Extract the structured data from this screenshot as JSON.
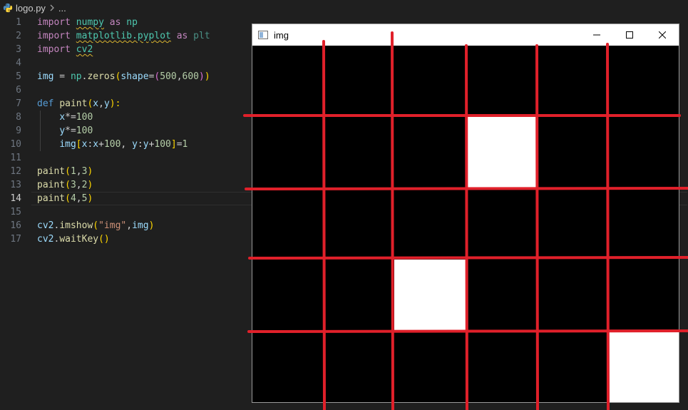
{
  "breadcrumb": {
    "file": "logo.py",
    "more": "..."
  },
  "line_numbers": [
    "1",
    "2",
    "3",
    "4",
    "5",
    "6",
    "7",
    "8",
    "9",
    "10",
    "11",
    "12",
    "13",
    "14",
    "15",
    "16",
    "17"
  ],
  "active_line": 14,
  "code": {
    "l1": {
      "kw": "import",
      "mod": "numpy",
      "kw2": "as",
      "alias": "np"
    },
    "l2": {
      "kw": "import",
      "mod": "matplotlib.pyplot",
      "kw2": "as",
      "alias": "plt"
    },
    "l3": {
      "kw": "import",
      "mod": "cv2"
    },
    "l5": {
      "var": "img",
      "op": " = ",
      "mod": "np",
      "dot": ".",
      "fn": "zeros",
      "po": "(",
      "param": "shape",
      "eq": "=",
      "pi": "(",
      "a": "500",
      "comma": ",",
      "b": "600",
      "pic": ")",
      "pc": ")"
    },
    "l7": {
      "kw": "def",
      "fn": "paint",
      "po": "(",
      "x": "x",
      "comma": ",",
      "y": "y",
      "pc": "):"
    },
    "l8": {
      "var": "x",
      "op": "*=",
      "num": "100"
    },
    "l9": {
      "var": "y",
      "op": "*=",
      "num": "100"
    },
    "l10": {
      "var": "img",
      "bo": "[",
      "x1": "x",
      "c1": ":",
      "x2": "x",
      "plus1": "+",
      "n1": "100",
      "comma": ", ",
      "y1": "y",
      "c2": ":",
      "y2": "y",
      "plus2": "+",
      "n2": "100",
      "bc": "]",
      "eq": "=",
      "val": "1"
    },
    "l12": {
      "fn": "paint",
      "po": "(",
      "a": "1",
      "comma": ",",
      "b": "3",
      "pc": ")"
    },
    "l13": {
      "fn": "paint",
      "po": "(",
      "a": "3",
      "comma": ",",
      "b": "2",
      "pc": ")"
    },
    "l14": {
      "fn": "paint",
      "po": "(",
      "a": "4",
      "comma": ",",
      "b": "5",
      "pc": ")"
    },
    "l16": {
      "mod": "cv2",
      "dot": ".",
      "fn": "imshow",
      "po": "(",
      "str": "\"img\"",
      "comma": ",",
      "var": "img",
      "pc": ")"
    },
    "l17": {
      "mod": "cv2",
      "dot": ".",
      "fn": "waitKey",
      "pc": "()"
    }
  },
  "window": {
    "title": "img",
    "white_cells": [
      {
        "row": 1,
        "col": 3
      },
      {
        "row": 3,
        "col": 2
      },
      {
        "row": 4,
        "col": 5
      }
    ],
    "grid_rows": 5,
    "grid_cols": 6
  },
  "colors": {
    "editor_bg": "#1f1f1f",
    "overlay_red": "#e0202a",
    "cell_white": "#ffffff"
  },
  "icons": [
    "python-file-icon",
    "chevron-right-icon",
    "window-app-icon",
    "minimize-icon",
    "maximize-icon",
    "close-icon"
  ]
}
